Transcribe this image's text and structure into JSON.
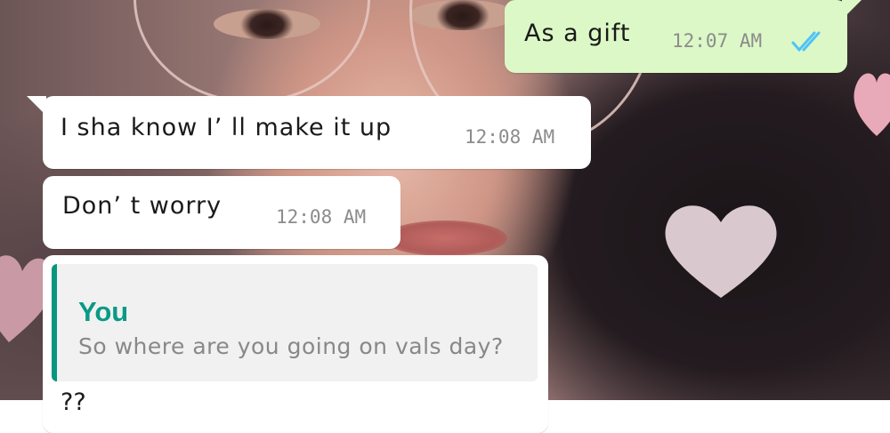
{
  "chat": {
    "messages": [
      {
        "direction": "outgoing",
        "text": "As a gift",
        "time": "12:07 AM",
        "status": "read-ticks-icon",
        "status_color": "#4fc3f7"
      },
      {
        "direction": "incoming",
        "text": "I sha know I’ ll make it up",
        "time": "12:08 AM"
      },
      {
        "direction": "incoming",
        "text": "Don’ t worry",
        "time": "12:08 AM"
      },
      {
        "direction": "incoming",
        "reply": {
          "author": "You",
          "text": "So where are you going on vals day?"
        },
        "text": "??"
      }
    ]
  },
  "colors": {
    "incoming_bubble": "#ffffff",
    "outgoing_bubble": "#dcf8c6",
    "reply_accent": "#07967e",
    "reply_author": "#0a9a85",
    "timestamp": "#8c8c8c"
  }
}
